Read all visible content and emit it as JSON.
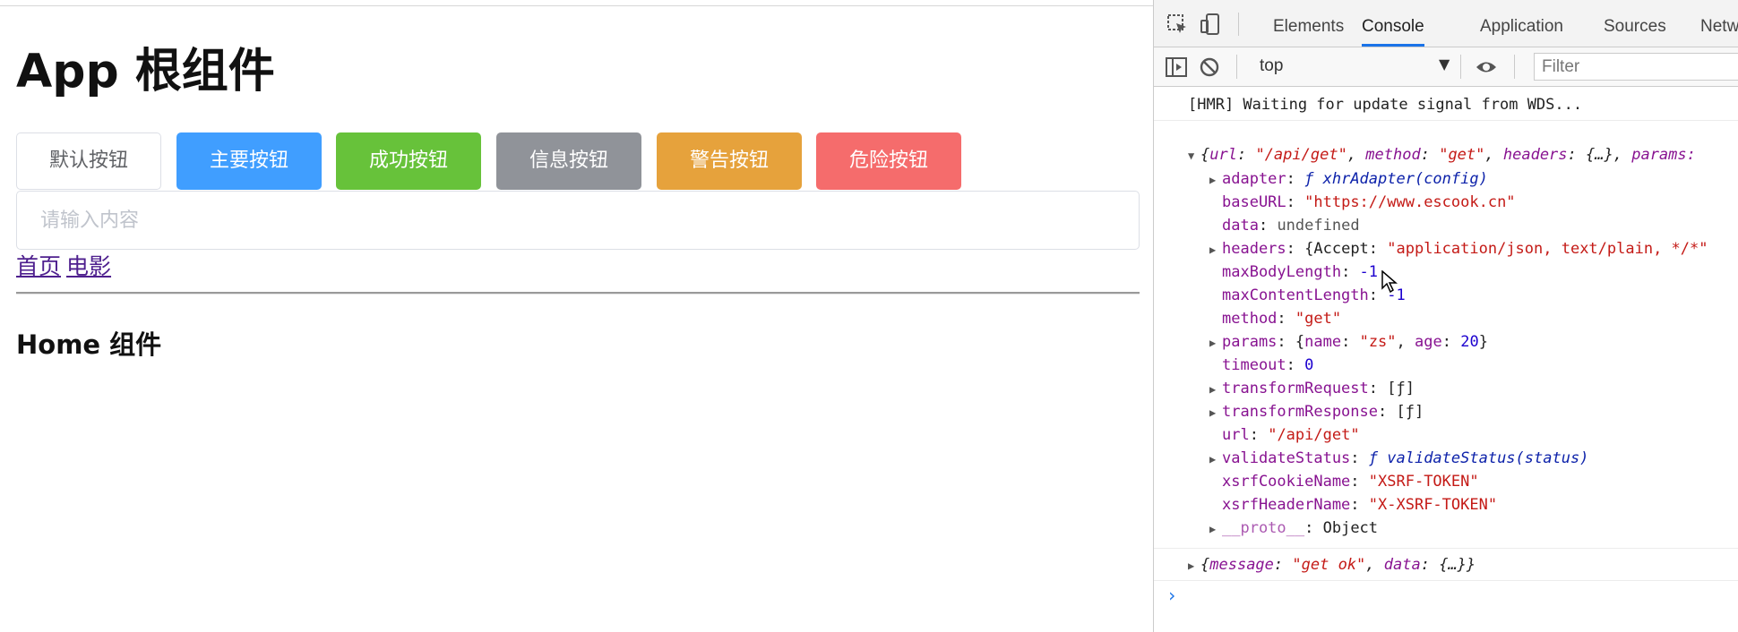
{
  "app": {
    "title": "App 根组件",
    "buttons": [
      {
        "label": "默认按钮",
        "type": "default"
      },
      {
        "label": "主要按钮",
        "type": "primary"
      },
      {
        "label": "成功按钮",
        "type": "success"
      },
      {
        "label": "信息按钮",
        "type": "info"
      },
      {
        "label": "警告按钮",
        "type": "warning"
      },
      {
        "label": "危险按钮",
        "type": "danger"
      }
    ],
    "input_placeholder": "请输入内容",
    "nav_links": [
      "首页",
      "电影"
    ],
    "home_title": "Home 组件"
  },
  "devtools": {
    "tabs": [
      "Elements",
      "Console",
      "Application",
      "Sources",
      "Netw"
    ],
    "active_tab": "Console",
    "context": "top",
    "filter_placeholder": "Filter",
    "console": {
      "hmr_message": "[HMR] Waiting for update signal from WDS...",
      "object_summary": {
        "url": "\"/api/get\"",
        "method": "\"get\"",
        "headers": "{…}",
        "params_label": "params:"
      },
      "properties": {
        "adapter_key": "adapter",
        "adapter_value": "ƒ xhrAdapter(config)",
        "baseURL_key": "baseURL",
        "baseURL_value": "\"https://www.escook.cn\"",
        "data_key": "data",
        "data_value": "undefined",
        "headers_key": "headers",
        "headers_value_pre": "{Accept: ",
        "headers_value_str": "\"application/json, text/plain, */*\"",
        "maxBodyLength_key": "maxBodyLength",
        "maxBodyLength_value": "-1",
        "maxContentLength_key": "maxContentLength",
        "maxContentLength_value": "-1",
        "method_key": "method",
        "method_value": "\"get\"",
        "params_key": "params",
        "params_name": "\"zs\"",
        "params_age": "20",
        "timeout_key": "timeout",
        "timeout_value": "0",
        "transformRequest_key": "transformRequest",
        "transformRequest_value": "[ƒ]",
        "transformResponse_key": "transformResponse",
        "transformResponse_value": "[ƒ]",
        "url_key": "url",
        "url_value": "\"/api/get\"",
        "validateStatus_key": "validateStatus",
        "validateStatus_value": "ƒ validateStatus(status)",
        "xsrfCookieName_key": "xsrfCookieName",
        "xsrfCookieName_value": "\"XSRF-TOKEN\"",
        "xsrfHeaderName_key": "xsrfHeaderName",
        "xsrfHeaderName_value": "\"X-XSRF-TOKEN\"",
        "proto_key": "__proto__",
        "proto_value": "Object"
      },
      "response_summary": {
        "message": "\"get ok\"",
        "data": "{…}"
      }
    }
  },
  "colors": {
    "primary": "#409eff",
    "success": "#67c23a",
    "info": "#909399",
    "warning": "#e6a23c",
    "danger": "#f56c6c",
    "devtools_accent": "#1a73e8"
  }
}
